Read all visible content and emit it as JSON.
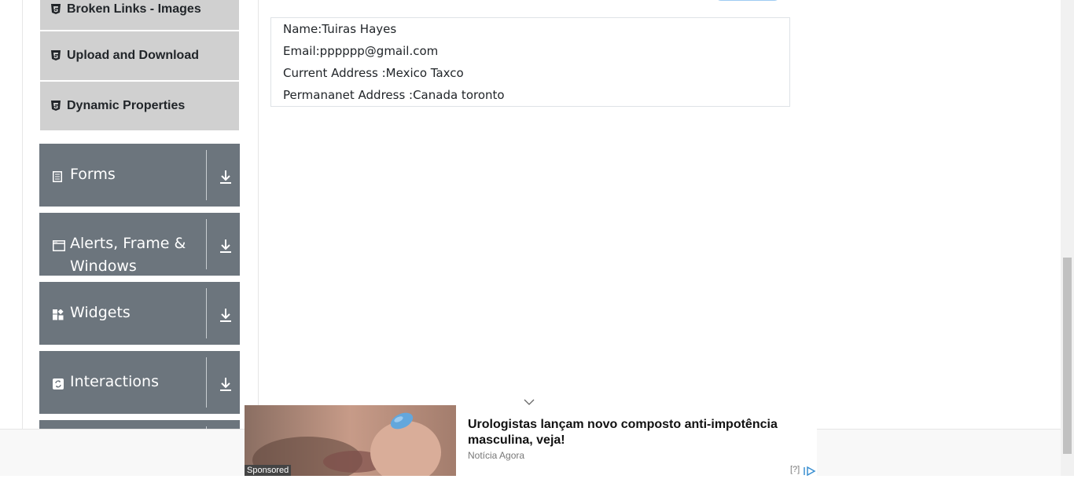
{
  "sidebar": {
    "sub_items": [
      {
        "label": "Broken Links - Images",
        "icon": "html5-icon"
      },
      {
        "label": "Upload and Download",
        "icon": "html5-icon"
      },
      {
        "label": "Dynamic Properties",
        "icon": "html5-icon"
      }
    ],
    "groups": [
      {
        "label": "Forms",
        "icon": "form-icon"
      },
      {
        "label": "Alerts, Frame & Windows",
        "icon": "window-icon"
      },
      {
        "label": "Widgets",
        "icon": "widgets-icon"
      },
      {
        "label": "Interactions",
        "icon": "interactions-icon"
      }
    ]
  },
  "output": {
    "name": "Name:Tuiras Hayes",
    "email": "Email:pppppp@gmail.com",
    "current_address": "Current Address :Mexico Taxco",
    "permanent_address": "Permananet Address :Canada toronto"
  },
  "ad": {
    "sponsored": "Sponsored",
    "headline": "Urologistas lançam novo composto anti-impotência masculina, veja!",
    "source": "Notícia Agora",
    "info": "[?]"
  },
  "colors": {
    "group_bg": "#6c757d",
    "sub_item_bg": "#d0d0d0"
  }
}
